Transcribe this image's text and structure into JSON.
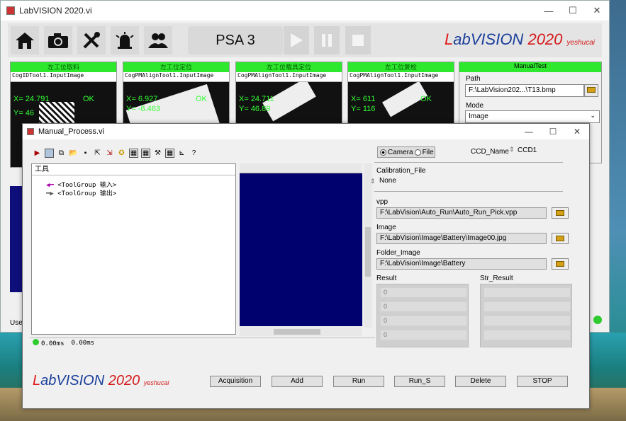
{
  "main_window": {
    "title": "LabVISION 2020.vi",
    "station_label": "PSA 3",
    "brand": {
      "lab_l": "L",
      "lab_rest": "ab",
      "vision": "VISION",
      "year": "2020",
      "suffix": "yeshucai"
    },
    "user_label": "Use"
  },
  "panels": [
    {
      "header": "左工位取料",
      "tool": "CogIDTool1.InputImage",
      "overlay1": "X= 24.791",
      "overlay2": "Y= 46",
      "status": "OK"
    },
    {
      "header": "左工位定位",
      "tool": "CogPMAlignTool1.InputImage",
      "overlay1": "X= 6.927",
      "overlay2": "Y= -6.463",
      "status": "OK"
    },
    {
      "header": "左工位载具定位",
      "tool": "CogPMAlignTool1.InputImage",
      "overlay1": "X= 24.711",
      "overlay2": "Y= 46.89",
      "status": "OK"
    },
    {
      "header": "左工位复检",
      "tool": "CogPMAlignTool1.InputImage",
      "overlay1": "X= 611",
      "overlay2": "Y= 116",
      "status": "OK"
    }
  ],
  "manual_test": {
    "header": "ManualTest",
    "path_label": "Path",
    "path_value": "F:\\LabVision202...\\T13.bmp",
    "mode_label": "Mode",
    "mode_value": "Image"
  },
  "dialog": {
    "title": "Manual_Process.vi",
    "tree_tab": "工具",
    "tree_items": [
      "<ToolGroup 输入>",
      "<ToolGroup 输出>"
    ],
    "status_time1": "0.00ms",
    "status_time2": "0.00ms",
    "source_camera": "Camera",
    "source_file": "File",
    "ccd_name_label": "CCD_Name",
    "ccd_name_value": "CCD1",
    "calibration_label": "Calibration_File",
    "calibration_value": "None",
    "vpp_label": "vpp",
    "vpp_value": "F:\\LabVision\\Auto_Run\\Auto_Run_Pick.vpp",
    "image_label": "Image",
    "image_value": "F:\\LabVision\\Image\\Battery\\Image00.jpg",
    "folder_label": "Folder_Image",
    "folder_value": "F:\\LabVision\\Image\\Battery",
    "result_label": "Result",
    "str_result_label": "Str_Result",
    "result_values": [
      "0",
      "0",
      "0",
      "0"
    ],
    "buttons": {
      "acquisition": "Acquisition",
      "add": "Add",
      "run": "Run",
      "run_s": "Run_S",
      "delete": "Delete",
      "stop": "STOP"
    }
  }
}
